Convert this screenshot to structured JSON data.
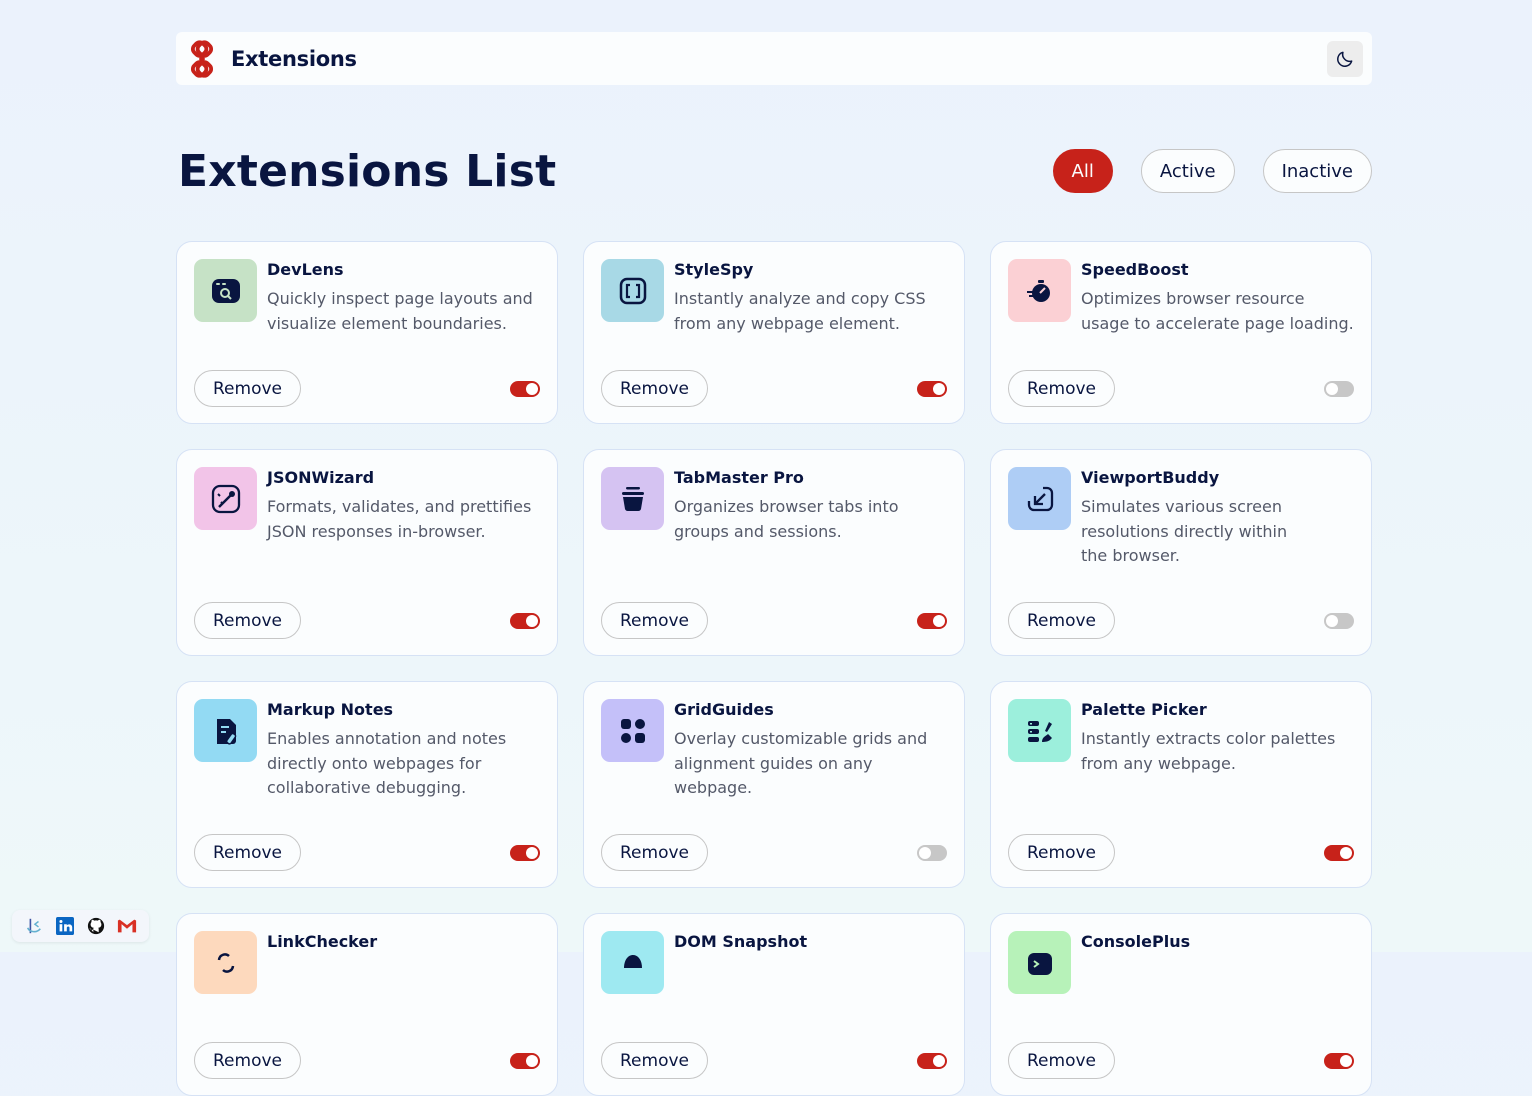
{
  "header": {
    "brand_name": "Extensions",
    "theme_toggle_icon": "moon-icon"
  },
  "page": {
    "title": "Extensions List"
  },
  "filters": [
    {
      "label": "All",
      "active": true
    },
    {
      "label": "Active",
      "active": false
    },
    {
      "label": "Inactive",
      "active": false
    }
  ],
  "remove_label": "Remove",
  "extensions": [
    {
      "name": "DevLens",
      "description": "Quickly inspect page layouts and visualize element boundaries.",
      "icon": "devlens-icon",
      "icon_bg": "#c6e2c6",
      "enabled": true
    },
    {
      "name": "StyleSpy",
      "description": "Instantly analyze and copy CSS from any webpage element.",
      "icon": "stylespy-icon",
      "icon_bg": "#a8d9e6",
      "enabled": true
    },
    {
      "name": "SpeedBoost",
      "description": "Optimizes browser resource usage to accelerate page loading.",
      "icon": "speedboost-icon",
      "icon_bg": "#fbd0d4",
      "enabled": false
    },
    {
      "name": "JSONWizard",
      "description": "Formats, validates, and prettifies JSON responses in-browser.",
      "icon": "jsonwizard-icon",
      "icon_bg": "#f2c4e8",
      "enabled": true
    },
    {
      "name": "TabMaster Pro",
      "description": "Organizes browser tabs into groups and sessions.",
      "icon": "tabmaster-icon",
      "icon_bg": "#d5c3f2",
      "enabled": true
    },
    {
      "name": "ViewportBuddy",
      "description": "Simulates various screen resolutions directly within the browser.",
      "icon": "viewportbuddy-icon",
      "icon_bg": "#aecdf5",
      "enabled": false
    },
    {
      "name": "Markup Notes",
      "description": "Enables annotation and notes directly onto webpages for collaborative debugging.",
      "icon": "markupnotes-icon",
      "icon_bg": "#93daf3",
      "enabled": true
    },
    {
      "name": "GridGuides",
      "description": "Overlay customizable grids and alignment guides on any webpage.",
      "icon": "gridguides-icon",
      "icon_bg": "#c4c0f9",
      "enabled": false
    },
    {
      "name": "Palette Picker",
      "description": "Instantly extracts color palettes from any webpage.",
      "icon": "palettepicker-icon",
      "icon_bg": "#9cefdc",
      "enabled": true
    },
    {
      "name": "LinkChecker",
      "description": "",
      "icon": "linkchecker-icon",
      "icon_bg": "#fdd9bd",
      "enabled": true
    },
    {
      "name": "DOM Snapshot",
      "description": "",
      "icon": "domsnapshot-icon",
      "icon_bg": "#9ee9f1",
      "enabled": true
    },
    {
      "name": "ConsolePlus",
      "description": "",
      "icon": "consoleplus-icon",
      "icon_bg": "#b7f2b9",
      "enabled": true
    }
  ],
  "social": [
    "frontend-mentor-icon",
    "linkedin-icon",
    "github-icon",
    "gmail-icon"
  ],
  "colors": {
    "accent": "#c7221a",
    "text_primary": "#091540",
    "text_secondary": "#545969",
    "toggle_off": "#c7c7c7"
  }
}
